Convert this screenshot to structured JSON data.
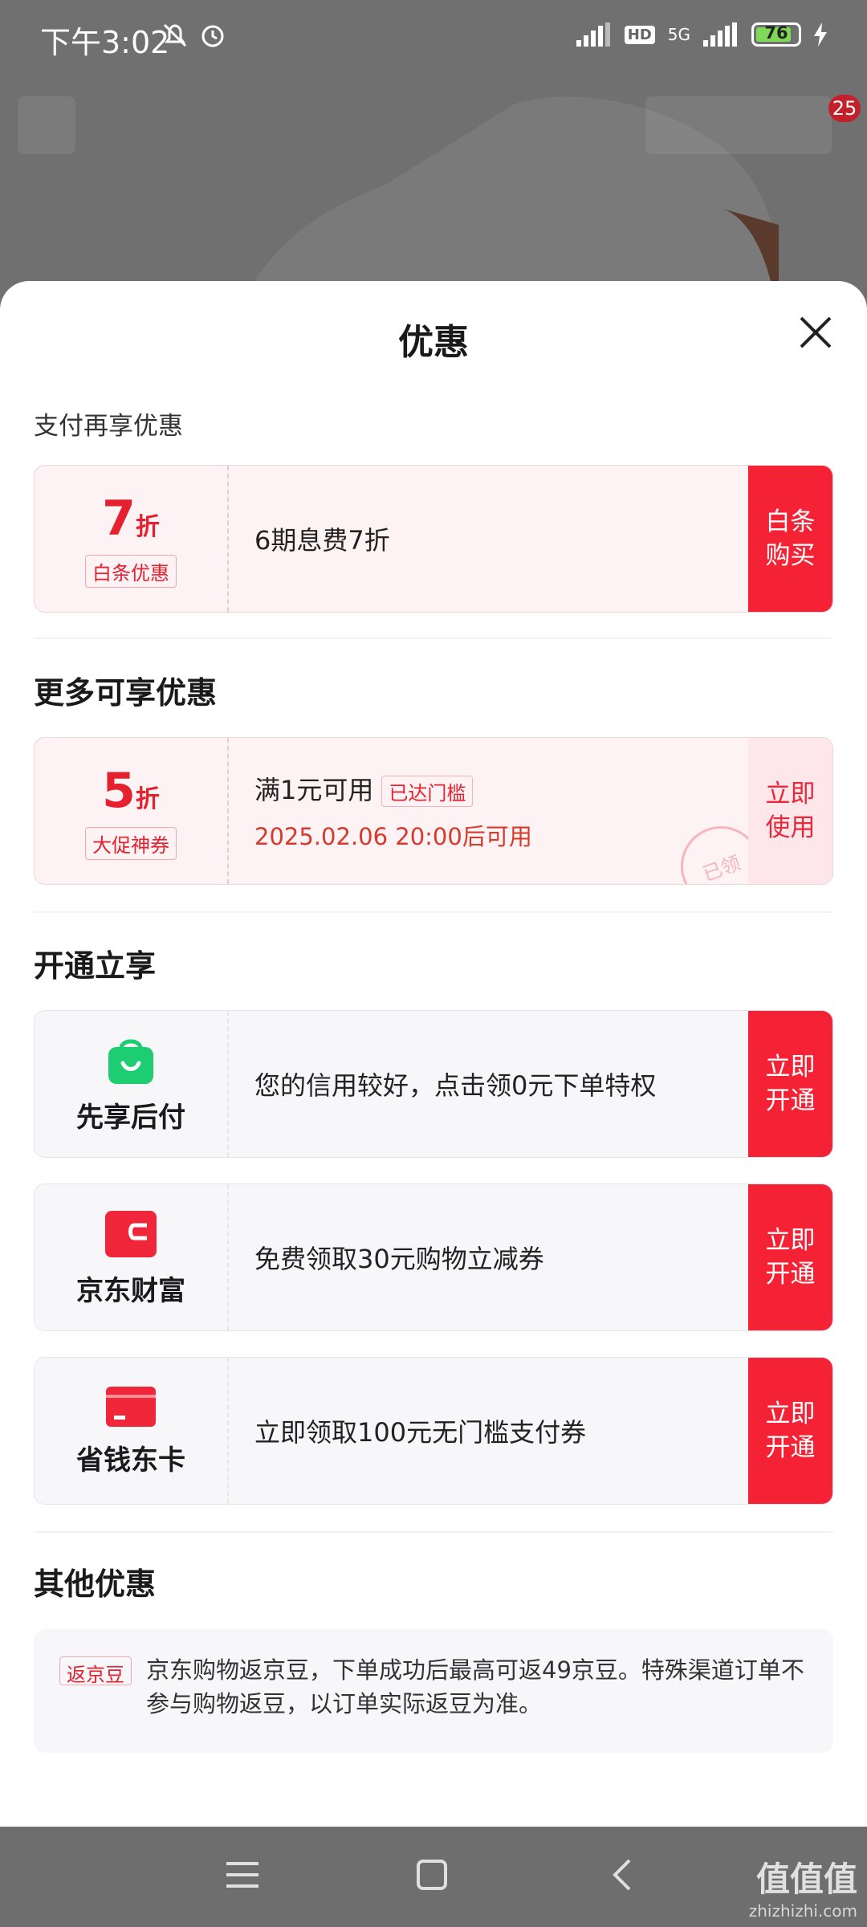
{
  "status_bar": {
    "time": "下午3:02",
    "network": "5G",
    "hd": "HD",
    "battery": "76",
    "battery_level": 0.76
  },
  "background": {
    "cart_badge": "25"
  },
  "sheet": {
    "title": "优惠",
    "section_pay": {
      "title": "支付再享优惠",
      "card": {
        "discount_num": "7",
        "discount_unit": "折",
        "tag": "白条优惠",
        "text": "6期息费7折",
        "button": [
          "白条",
          "购买"
        ]
      }
    },
    "section_more": {
      "title": "更多可享优惠",
      "card": {
        "discount_num": "5",
        "discount_unit": "折",
        "tag": "大促神券",
        "text": "满1元可用",
        "inline_tag": "已达门槛",
        "subtext": "2025.02.06 20:00后可用",
        "stamp": "已领",
        "button": [
          "立即",
          "使用"
        ]
      }
    },
    "section_open": {
      "title": "开通立享",
      "cards": [
        {
          "label": "先享后付",
          "text": "您的信用较好，点击领0元下单特权",
          "button": [
            "立即",
            "开通"
          ],
          "icon": "shopping-bag-icon",
          "color": "#1dcd72"
        },
        {
          "label": "京东财富",
          "text": "免费领取30元购物立减券",
          "button": [
            "立即",
            "开通"
          ],
          "icon": "wallet-icon",
          "color": "#f0273a"
        },
        {
          "label": "省钱东卡",
          "text": "立即领取100元无门槛支付券",
          "button": [
            "立即",
            "开通"
          ],
          "icon": "card-icon",
          "color": "#f0273a"
        }
      ]
    },
    "section_other": {
      "title": "其他优惠",
      "tag": "返京豆",
      "text": "京东购物返京豆，下单成功后最高可返49京豆。特殊渠道订单不参与购物返豆，以订单实际返豆为准。"
    }
  },
  "nav_bar": {
    "watermark": "值值值",
    "watermark_url": "zhizhizhi.com"
  },
  "colors": {
    "accent_red": "#f52236",
    "pink_bg": "#fef3f4",
    "green": "#1dcd72"
  }
}
